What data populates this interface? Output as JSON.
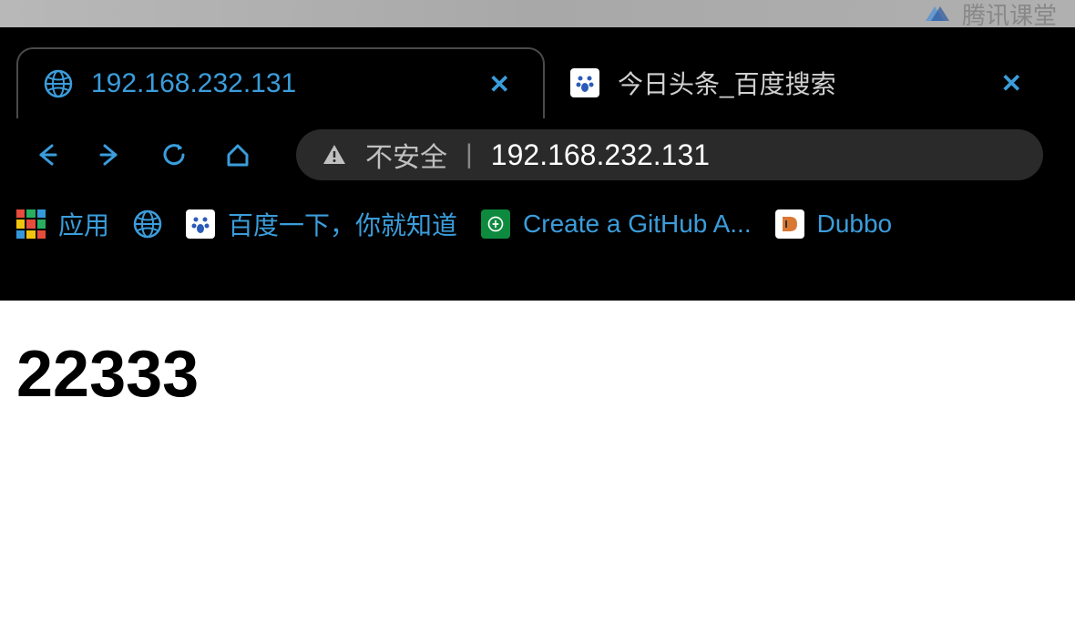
{
  "banner": {
    "text": "腾讯课堂"
  },
  "tabs": [
    {
      "title": "192.168.232.131",
      "close": "✕",
      "active": true
    },
    {
      "title": "今日头条_百度搜索",
      "close": "✕",
      "active": false
    }
  ],
  "address_bar": {
    "insecure_label": "不安全",
    "url": "192.168.232.131"
  },
  "bookmarks": {
    "apps_label": "应用",
    "baidu_label": "百度一下，你就知道",
    "github_label": "Create a GitHub A...",
    "dubbo_label": "Dubbo"
  },
  "page": {
    "heading": "22333"
  }
}
